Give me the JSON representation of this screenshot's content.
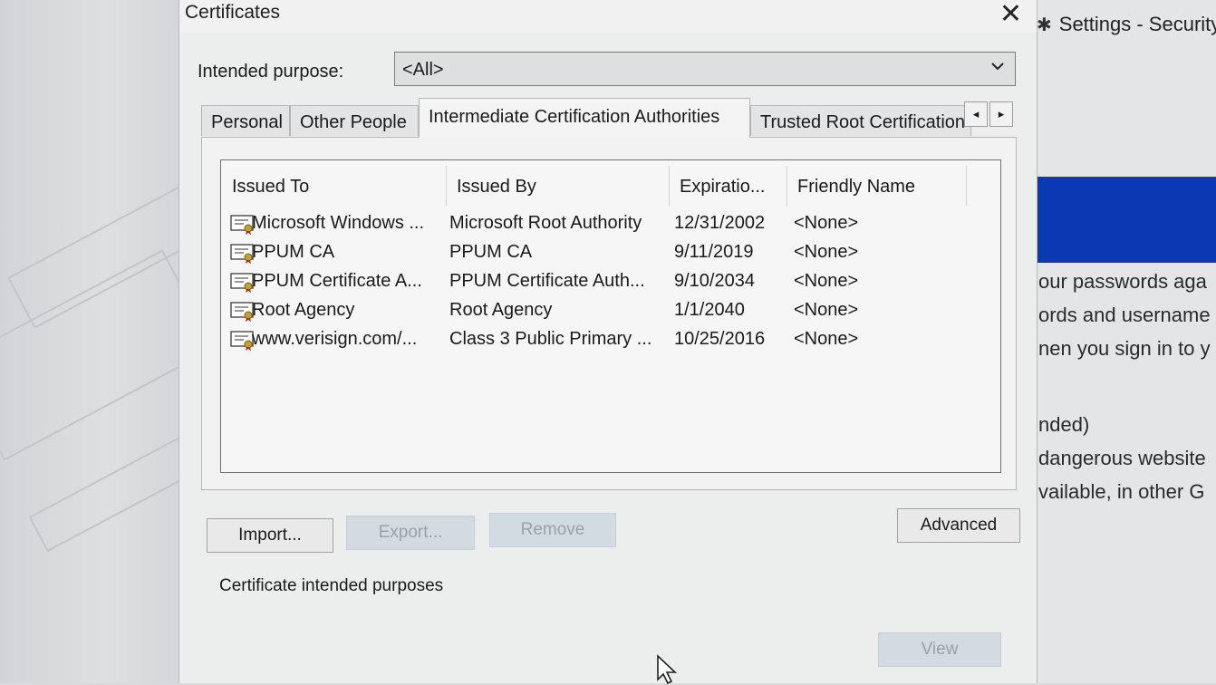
{
  "dialog": {
    "title": "Certificates",
    "intended_purpose_label": "Intended purpose:",
    "intended_purpose_value": "<All>",
    "tabs": [
      {
        "label": "Personal",
        "active": false
      },
      {
        "label": "Other People",
        "active": false
      },
      {
        "label": "Intermediate Certification Authorities",
        "active": true
      },
      {
        "label": "Trusted Root Certification",
        "active": false
      }
    ],
    "columns": [
      "Issued To",
      "Issued By",
      "Expiratio...",
      "Friendly Name"
    ],
    "rows": [
      [
        "Microsoft Windows ...",
        "Microsoft Root Authority",
        "12/31/2002",
        "<None>"
      ],
      [
        "PPUM CA",
        "PPUM CA",
        "9/11/2019",
        "<None>"
      ],
      [
        "PPUM Certificate A...",
        "PPUM Certificate Auth...",
        "9/10/2034",
        "<None>"
      ],
      [
        "Root Agency",
        "Root Agency",
        "1/1/2040",
        "<None>"
      ],
      [
        "www.verisign.com/...",
        "Class 3 Public Primary ...",
        "10/25/2016",
        "<None>"
      ]
    ],
    "buttons": {
      "import": "Import...",
      "export": "Export...",
      "remove": "Remove",
      "advanced": "Advanced",
      "view": "View"
    },
    "intended_purposes_label": "Certificate intended purposes"
  },
  "background": {
    "window_title": "Settings - Security",
    "text_lines": [
      "our passwords aga",
      "ords and username",
      "nen you sign in to y",
      "nded)",
      "dangerous website",
      "vailable, in other G"
    ]
  },
  "icons": {
    "close": "close-icon",
    "dropdown": "chevron-down-icon",
    "certificate": "certificate-icon",
    "settings": "gear-icon",
    "cursor": "mouse-pointer-icon"
  }
}
